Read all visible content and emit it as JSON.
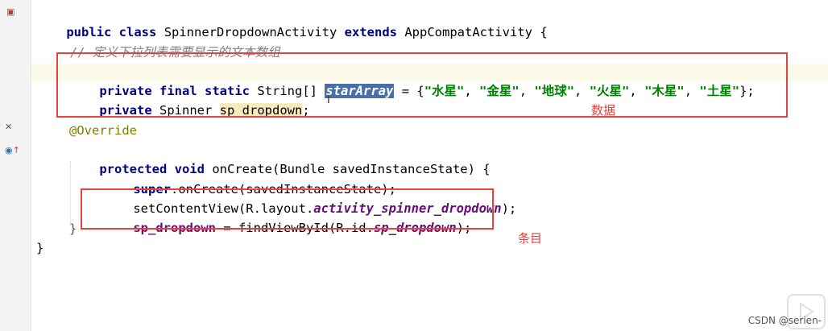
{
  "code": {
    "line1": {
      "kw1": "public",
      "kw2": "class",
      "cls": "SpinnerDropdownActivity",
      "kw3": "extends",
      "sup": "AppCompatActivity",
      "brace": "{"
    },
    "comment": "// 定义下拉列表需要显示的文本数组",
    "line3": {
      "kw1": "private",
      "kw2": "final",
      "kw3": "static",
      "type": "String[]",
      "field": "starArray",
      "eq": " = {",
      "s1": "\"水星\"",
      "s2": "\"金星\"",
      "s3": "\"地球\"",
      "s4": "\"火星\"",
      "s5": "\"木星\"",
      "s6": "\"土星\"",
      "sep": ", ",
      "end": "};"
    },
    "line4": {
      "kw1": "private",
      "type": "Spinner",
      "field": "sp_dropdown",
      "end": ";"
    },
    "annotation": "@Override",
    "line6": {
      "kw1": "protected",
      "kw2": "void",
      "rest": "onCreate(Bundle savedInstanceState) {"
    },
    "line7": {
      "kw": "super",
      "rest": ".onCreate(savedInstanceState);"
    },
    "line8": {
      "pre": "setContentView(R.layout.",
      "field": "activity_spinner_dropdown",
      "end": ");"
    },
    "line9": {
      "field": "sp_dropdown",
      "mid": " = findViewById(R.id.",
      "field2": "sp_dropdown",
      "end": ");"
    },
    "close_inner": "}",
    "close_outer": "}"
  },
  "annotations": {
    "data_label": "数据",
    "item_label": "条目"
  },
  "watermark": "CSDN @serien-",
  "colors": {
    "box": "#e8403a",
    "keyword": "#000080",
    "string": "#008000",
    "field": "#660e7a"
  }
}
